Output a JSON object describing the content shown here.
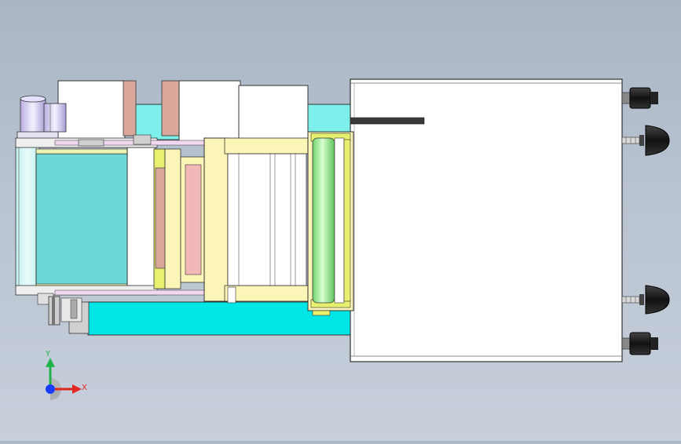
{
  "triad": {
    "y_label": "Y",
    "x_label": "X",
    "y_color": "#22b14c",
    "x_color": "#e0281e",
    "z_color": "#1a3cff"
  },
  "colors": {
    "background": "#b4bfcd",
    "cabinet": "#ffffff",
    "cyan_base": "#00e5e5",
    "conveyor_belt": "#6ed8d6",
    "pink_plate": "#f2b8b8",
    "brown_strip": "#d8a89a",
    "yellow_frame": "#fbf6b8",
    "roller_green": "#a8f0a0",
    "lavender": "#d8c8f0",
    "caster_black": "#1a1a1a"
  },
  "icons": {
    "motor": "motor-icon",
    "caster": "caster-wheel-icon",
    "roller": "roller-icon",
    "axis_triad": "axis-triad-icon"
  }
}
